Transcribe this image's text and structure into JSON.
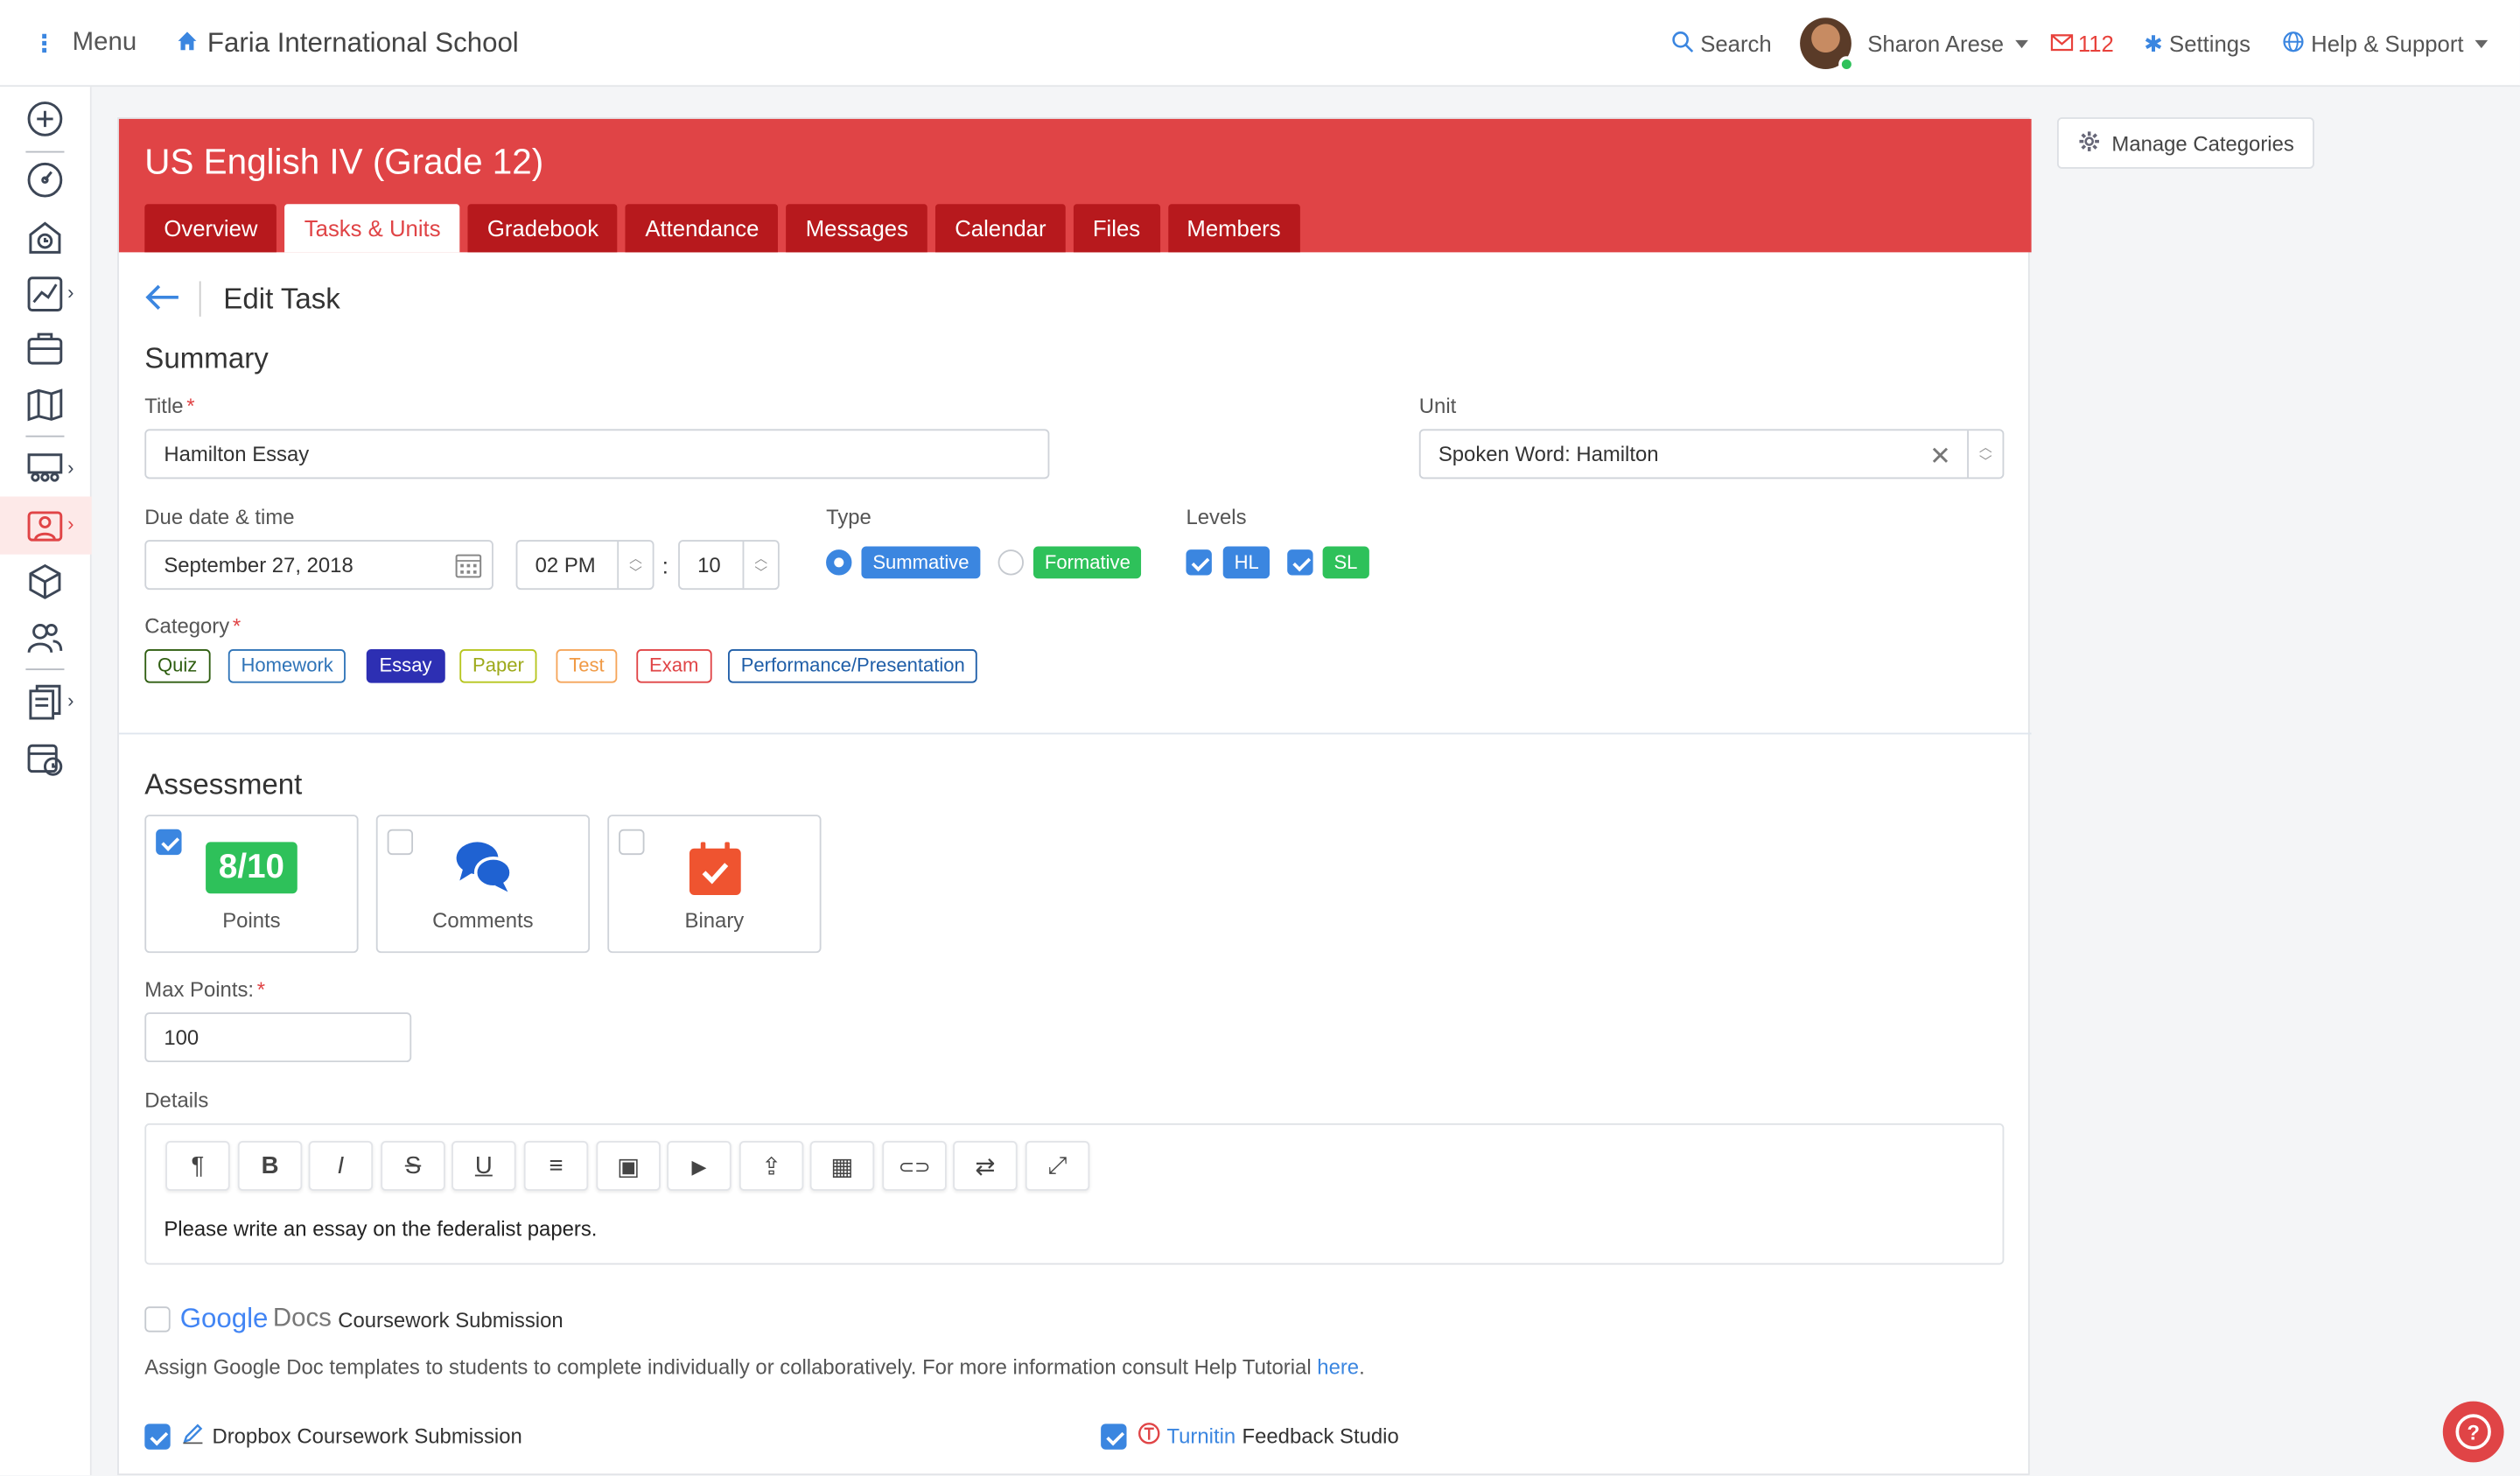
{
  "topbar": {
    "menu_label": "Menu",
    "school_name": "Faria International School",
    "search_label": "Search",
    "user_name": "Sharon Arese",
    "mail_count": "112",
    "settings_label": "Settings",
    "help_label": "Help & Support"
  },
  "sidenav": {
    "icons": [
      "add-icon",
      "dashboard-icon",
      "school-icon",
      "analytics-icon",
      "briefcase-icon",
      "map-icon",
      "classes-icon",
      "teacher-icon",
      "box-icon",
      "people-icon",
      "reports-icon",
      "calendar-icon"
    ],
    "active": "teacher-icon"
  },
  "course": {
    "title": "US English IV (Grade 12)",
    "tabs": [
      "Overview",
      "Tasks & Units",
      "Gradebook",
      "Attendance",
      "Messages",
      "Calendar",
      "Files",
      "Members"
    ],
    "active_tab": "Tasks & Units"
  },
  "page": {
    "heading": "Edit Task",
    "summary_heading": "Summary"
  },
  "form": {
    "title_label": "Title",
    "title_value": "Hamilton Essay",
    "unit_label": "Unit",
    "unit_value": "Spoken Word: Hamilton",
    "due_label": "Due date & time",
    "due_date": "September 27, 2018",
    "due_hour": "02 PM",
    "time_separator": ":",
    "due_minute": "10",
    "type_label": "Type",
    "type_options": [
      "Summative",
      "Formative"
    ],
    "type_selected": "Summative",
    "levels_label": "Levels",
    "levels": [
      {
        "label": "HL",
        "checked": true
      },
      {
        "label": "SL",
        "checked": true
      }
    ],
    "category_label": "Category",
    "categories": [
      "Quiz",
      "Homework",
      "Essay",
      "Paper",
      "Test",
      "Exam",
      "Performance/Presentation"
    ],
    "category_selected": "Essay"
  },
  "assessment": {
    "heading": "Assessment",
    "options": [
      {
        "label": "Points",
        "badge": "8/10",
        "checked": true
      },
      {
        "label": "Comments",
        "checked": false
      },
      {
        "label": "Binary",
        "checked": false
      }
    ],
    "max_points_label": "Max Points:",
    "max_points_value": "100",
    "details_label": "Details",
    "details_text": "Please write an essay on the federalist papers.",
    "toolbar_buttons": [
      "paragraph-icon",
      "bold-icon",
      "italic-icon",
      "strikethrough-icon",
      "underline-icon",
      "list-icon",
      "image-icon",
      "video-icon",
      "upload-icon",
      "table-icon",
      "link-icon",
      "swap-icon",
      "fullscreen-icon"
    ],
    "toolbar_glyphs": [
      "¶",
      "B",
      "I",
      "S",
      "U",
      "≡",
      "▣",
      "▶",
      "⇪",
      "▦",
      "⊂⊃",
      "⇄",
      "⤢"
    ]
  },
  "submission": {
    "google_word": "Google",
    "docs_word": "Docs",
    "google_label": "Coursework Submission",
    "google_checked": false,
    "help_text": "Assign Google Doc templates to students to complete individually or collaboratively. For more information consult Help Tutorial",
    "help_link": "here",
    "help_end": ".",
    "dropbox_label": "Dropbox Coursework Submission",
    "dropbox_checked": true,
    "turnitin_link": "Turnitin",
    "turnitin_label": "Feedback Studio",
    "turnitin_checked": true
  },
  "side": {
    "manage_categories": "Manage Categories"
  },
  "colors": {
    "brand_red": "#e04446",
    "tab_dark_red": "#b7191d",
    "accent_blue": "#3b86e0",
    "green": "#2ec15a"
  }
}
